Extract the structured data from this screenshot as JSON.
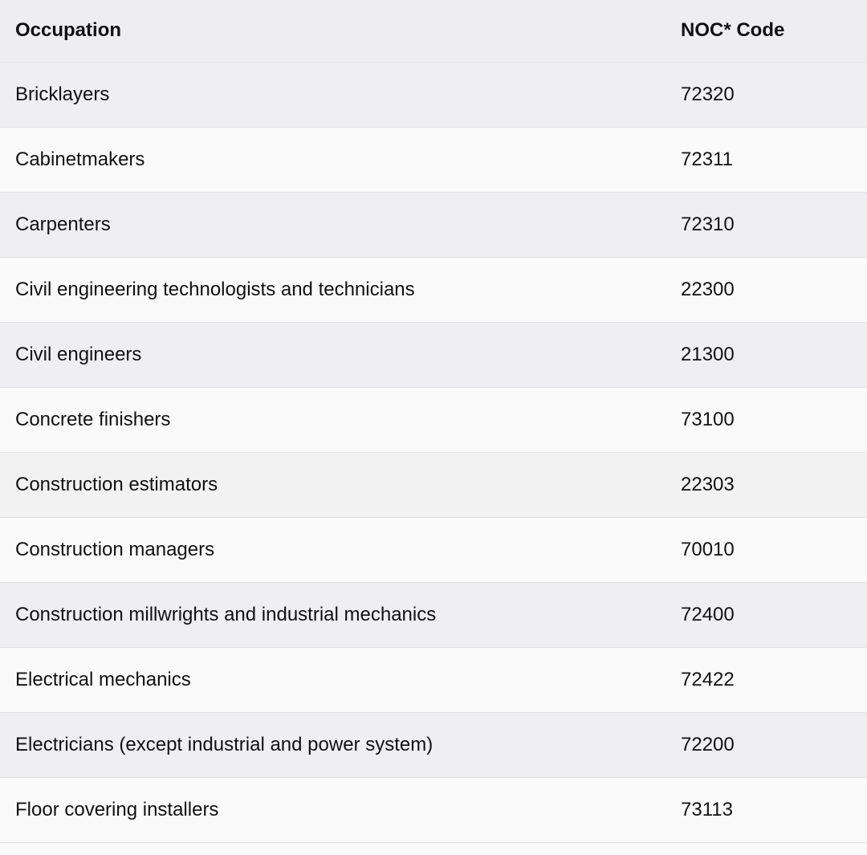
{
  "table": {
    "headers": {
      "occupation": "Occupation",
      "code": "NOC* Code"
    },
    "rows": [
      {
        "occupation": "Bricklayers",
        "code": "72320"
      },
      {
        "occupation": "Cabinetmakers",
        "code": "72311"
      },
      {
        "occupation": "Carpenters",
        "code": "72310"
      },
      {
        "occupation": "Civil engineering technologists and technicians",
        "code": "22300"
      },
      {
        "occupation": "Civil engineers",
        "code": "21300"
      },
      {
        "occupation": "Concrete finishers",
        "code": "73100"
      },
      {
        "occupation": "Construction estimators",
        "code": "22303"
      },
      {
        "occupation": "Construction managers",
        "code": "70010"
      },
      {
        "occupation": "Construction millwrights and industrial mechanics",
        "code": "72400"
      },
      {
        "occupation": "Electrical mechanics",
        "code": "72422"
      },
      {
        "occupation": "Electricians (except industrial and power system)",
        "code": "72200"
      },
      {
        "occupation": "Floor covering installers",
        "code": "73113"
      }
    ]
  }
}
